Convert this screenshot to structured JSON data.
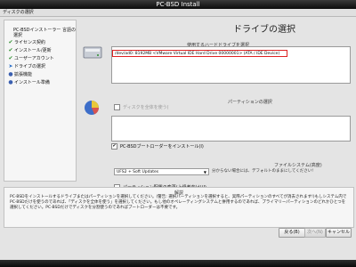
{
  "window": {
    "title": "PC-BSD Install",
    "subtitle": "ディスクの選択"
  },
  "sidebar": {
    "heading": "PC-BSDインストーラー 言語の選択",
    "items": [
      {
        "label": "ライセンス契約",
        "state": "done"
      },
      {
        "label": "インストール/更新",
        "state": "done"
      },
      {
        "label": "ユーザーアカウント",
        "state": "done"
      },
      {
        "label": "ドライブの選択",
        "state": "current"
      },
      {
        "label": "拡張機能",
        "state": "pending"
      },
      {
        "label": "インストール準備",
        "state": "pending"
      }
    ]
  },
  "main": {
    "title": "ドライブの選択",
    "disk_section_label": "使用するハードドライブを選択",
    "disk_entry": "/dev/ad0: 8192MB <VMware Virtual IDE Hard Drive 00000001> (ATA / IDE Device)",
    "partition_label": "パーティションの選択",
    "show_disk_label": "ディスクを全体を使う(",
    "bootloader_label": "PC-BSDブートローダーをインストール(I)",
    "fs_label": "ファイルシステム(高度)",
    "fs_option": "UFS2 + Soft Updates",
    "fs_hint": "分からない場合には、デフォルトのままにしてください!",
    "alt_layout_label": "パーティション配置の変更(上級者向け)(J)"
  },
  "help": {
    "title": "解説",
    "text": "PC-BSDをインストールするドライブまたはパーティションを選択してください。(警告: 選択パーティションを選択すると、実際パーティションのすべてが消去されます!)もしシステム内でPC-BSDだけを使うのであれば、「ディスクを全体を使う」を選択してください。もし他のオペレーティングシステムと併用するのであれば、プライマリーパーティションのどれかひとつを選択してください。PC-BSDだけでディスクを分割使うのであればブートローダーは不要です。"
  },
  "buttons": {
    "back": "戻る(B)",
    "next": "次へ(N)",
    "cancel": "キャンセル"
  }
}
